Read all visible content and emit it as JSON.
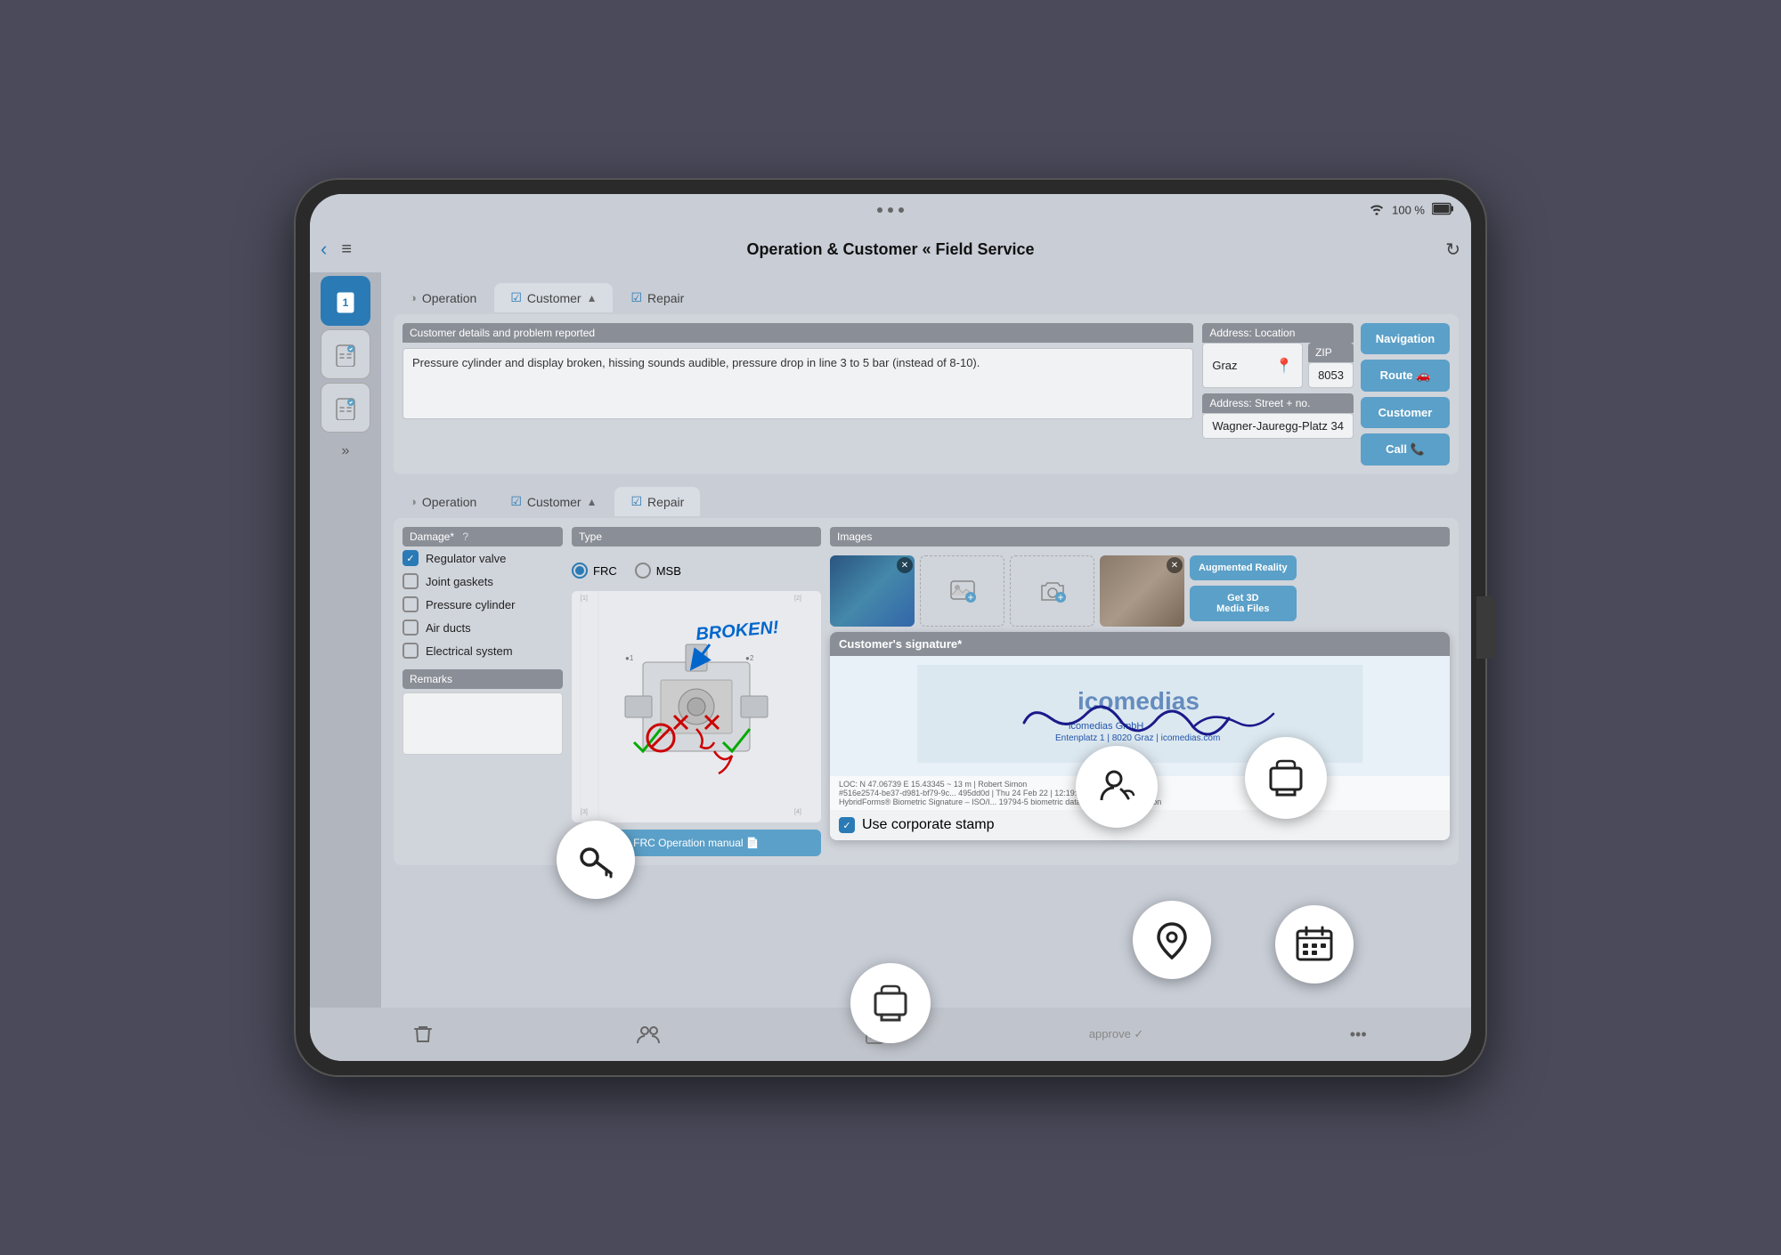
{
  "device": {
    "status_bar": {
      "dots": [
        "•",
        "•",
        "•"
      ],
      "wifi": "wifi",
      "battery": "100 %"
    },
    "title": "Operation & Customer « Field Service"
  },
  "tabs_top": {
    "tab1": {
      "label": "Operation",
      "icon": "half-circle",
      "active": false
    },
    "tab2": {
      "label": "Customer",
      "icon": "check",
      "active": true,
      "arrow": "▲"
    },
    "tab3": {
      "label": "Repair",
      "icon": "check",
      "active": false
    }
  },
  "customer_section": {
    "field_label": "Customer details and problem reported",
    "field_value": "Pressure cylinder and display broken, hissing sounds audible, pressure drop in line 3 to 5 bar (instead of 8-10).",
    "address_location_label": "Address: Location",
    "city": "Graz",
    "zip_label": "ZIP",
    "zip_value": "8053",
    "address_street_label": "Address: Street + no.",
    "street_value": "Wagner-Jauregg-Platz 34",
    "nav_button": "Navigation",
    "route_button": "Route 🚗",
    "customer_button": "Customer",
    "call_button": "Call 📞"
  },
  "tabs_bottom": {
    "tab1": {
      "label": "Operation",
      "icon": "half-circle",
      "active": false
    },
    "tab2": {
      "label": "Customer",
      "icon": "check",
      "active": false,
      "arrow": "▲"
    },
    "tab3": {
      "label": "Repair",
      "icon": "check",
      "active": true
    }
  },
  "repair_section": {
    "damage_label": "Damage*",
    "damage_items": [
      {
        "label": "Regulator valve",
        "checked": true
      },
      {
        "label": "Joint gaskets",
        "checked": false
      },
      {
        "label": "Pressure cylinder",
        "checked": false
      },
      {
        "label": "Air ducts",
        "checked": false
      },
      {
        "label": "Electrical system",
        "checked": false
      }
    ],
    "remarks_label": "Remarks",
    "type_label": "Type",
    "radio_options": [
      {
        "label": "FRC",
        "selected": true
      },
      {
        "label": "MSB",
        "selected": false
      }
    ],
    "manual_button": "FRC Operation manual 📄",
    "images_label": "Images",
    "ar_button": "Augmented Reality",
    "media_button": "Get 3D\nMedia Files"
  },
  "signature": {
    "header": "Customer's signature*",
    "location": "LOC: N 47.06739  E 15.43345  ~ 13 m  | Robert Simon",
    "hash": "#516e2574-be37-d981-bf79-9c... 495dd0d | Thu 24 Feb 22 | 12:19:41 GMT+0100",
    "biometric": "HybridForms® Biometric Signature – ISO/I... 19794-5 biometric data ...tected by encryption",
    "stamp_label": "Use corporate stamp"
  },
  "toolbar": {
    "delete_icon": "🗑",
    "users_icon": "👥",
    "stamp_icon": "stamp",
    "doc_icon": "📄",
    "approve_label": "approve ✓",
    "more_icon": "•••"
  },
  "floating_icons": {
    "key": "key",
    "signature_pen": "signature_pen",
    "stamp_large": "stamp_large",
    "location_pin": "location_pin",
    "calendar": "calendar",
    "stamp_bottom": "stamp_bottom"
  }
}
